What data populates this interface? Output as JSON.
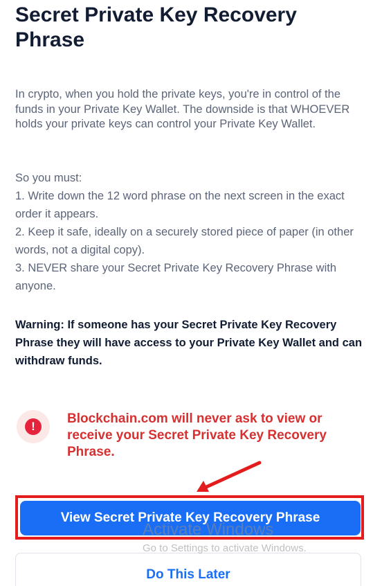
{
  "page": {
    "title": "Secret Private Key Recovery Phrase",
    "intro": "In crypto, when you hold the private keys, you're in control of the funds in your Private Key Wallet. The downside is that WHOEVER holds your private keys can control your Private Key Wallet.",
    "steps_heading": "So you must:",
    "steps": [
      "1. Write down the 12 word phrase on the next screen in the exact order it appears.",
      "2. Keep it safe, ideally on a securely stored piece of paper (in other words, not a digital copy).",
      "3. NEVER share your Secret Private Key Recovery Phrase with anyone."
    ],
    "warning": "Warning: If someone has your Secret Private Key Recovery Phrase they will have access to your Private Key Wallet and can withdraw funds."
  },
  "alert": {
    "icon": "exclamation-icon",
    "icon_glyph": "!",
    "text": "Blockchain.com will never ask to view or receive your Secret Private Key Recovery Phrase.",
    "color": "#d63031"
  },
  "actions": {
    "primary_label": "View Secret Private Key Recovery Phrase",
    "secondary_label": "Do This Later",
    "primary_color": "#1a6ef5"
  },
  "annotation": {
    "highlight_color": "#e31d1d"
  },
  "overlay": {
    "title": "Activate Windows",
    "subtitle": "Go to Settings to activate Windows."
  }
}
